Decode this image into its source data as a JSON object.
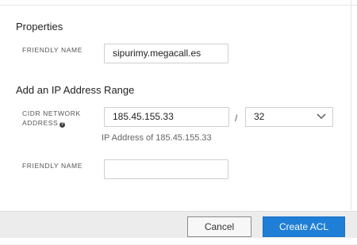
{
  "properties": {
    "title": "Properties",
    "friendly_name_label": "FRIENDLY NAME",
    "friendly_name_value": "sipurimy.megacall.es"
  },
  "ip_range": {
    "title": "Add an IP Address Range",
    "cidr_label_line1": "CIDR NETWORK",
    "cidr_label_line2": "ADDRESS",
    "cidr_value": "185.45.155.33",
    "separator": "/",
    "prefix_selected": "32",
    "hint": "IP Address of 185.45.155.33",
    "friendly_name_label": "FRIENDLY NAME",
    "friendly_name_value": ""
  },
  "footer": {
    "cancel_label": "Cancel",
    "create_label": "Create ACL"
  },
  "colors": {
    "primary": "#1f7fd6",
    "footer_bg": "#ececec"
  },
  "icons": [
    "help-icon",
    "chevron-down-icon"
  ]
}
